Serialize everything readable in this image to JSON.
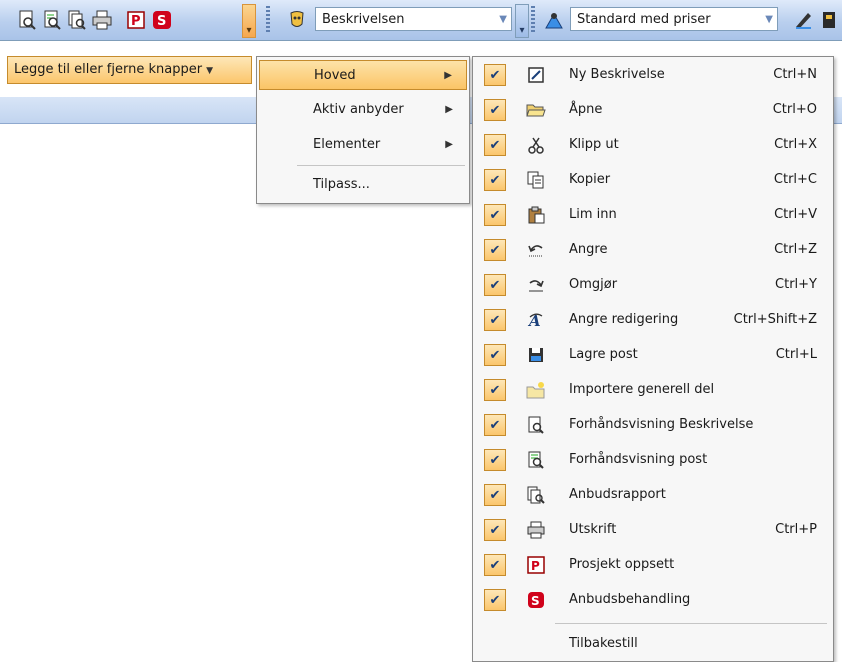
{
  "toolbar": {
    "combo1_value": "Beskrivelsen",
    "combo2_value": "Standard med priser"
  },
  "add_remove_label": "Legge til eller fjerne knapper",
  "submenu1": {
    "items": [
      {
        "label": "Hoved",
        "has_submenu": true,
        "highlighted": true
      },
      {
        "label": "Aktiv anbyder",
        "has_submenu": true
      },
      {
        "label": "Elementer",
        "has_submenu": true
      },
      {
        "label": "Tilpass...",
        "has_submenu": false
      }
    ]
  },
  "submenu2": {
    "items": [
      {
        "label": "Ny Beskrivelse",
        "shortcut": "Ctrl+N",
        "icon": "new-document-icon",
        "checked": true
      },
      {
        "label": "Åpne",
        "shortcut": "Ctrl+O",
        "icon": "open-folder-icon",
        "checked": true
      },
      {
        "label": "Klipp ut",
        "shortcut": "Ctrl+X",
        "icon": "scissors-icon",
        "checked": true
      },
      {
        "label": "Kopier",
        "shortcut": "Ctrl+C",
        "icon": "copy-icon",
        "checked": true
      },
      {
        "label": "Lim inn",
        "shortcut": "Ctrl+V",
        "icon": "paste-icon",
        "checked": true
      },
      {
        "label": "Angre",
        "shortcut": "Ctrl+Z",
        "icon": "undo-icon",
        "checked": true
      },
      {
        "label": "Omgjør",
        "shortcut": "Ctrl+Y",
        "icon": "redo-icon",
        "checked": true
      },
      {
        "label": "Angre redigering",
        "shortcut": "Ctrl+Shift+Z",
        "icon": "revert-edit-icon",
        "checked": true
      },
      {
        "label": "Lagre post",
        "shortcut": "Ctrl+L",
        "icon": "save-icon",
        "checked": true
      },
      {
        "label": "Importere generell del",
        "shortcut": "",
        "icon": "import-folder-icon",
        "checked": true
      },
      {
        "label": "Forhåndsvisning Beskrivelse",
        "shortcut": "",
        "icon": "preview-description-icon",
        "checked": true
      },
      {
        "label": "Forhåndsvisning post",
        "shortcut": "",
        "icon": "preview-post-icon",
        "checked": true
      },
      {
        "label": "Anbudsrapport",
        "shortcut": "",
        "icon": "report-icon",
        "checked": true
      },
      {
        "label": "Utskrift",
        "shortcut": "Ctrl+P",
        "icon": "printer-icon",
        "checked": true
      },
      {
        "label": "Prosjekt oppsett",
        "shortcut": "",
        "icon": "project-setup-icon",
        "checked": true
      },
      {
        "label": "Anbudsbehandling",
        "shortcut": "",
        "icon": "tender-handling-icon",
        "checked": true
      }
    ],
    "reset_label": "Tilbakestill"
  },
  "colors": {
    "highlight_start": "#fde3a8",
    "highlight_end": "#fbc466",
    "toolbar_blue": "#b9cfee",
    "check_color": "#1a3f7a",
    "red_icon": "#d0021b"
  }
}
